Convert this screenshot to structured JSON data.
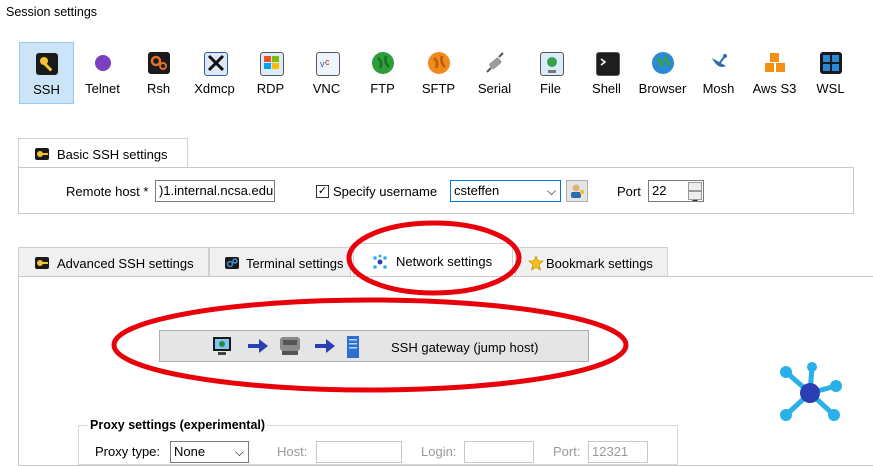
{
  "window": {
    "title": "Session settings"
  },
  "session_types": [
    {
      "label": "SSH",
      "icon": "ssh-key-icon",
      "color": "#d4a017",
      "selected": true
    },
    {
      "label": "Telnet",
      "icon": "telnet-icon",
      "color": "#7b3fbf",
      "selected": false
    },
    {
      "label": "Rsh",
      "icon": "rsh-icon",
      "color": "#c65a1e",
      "selected": false
    },
    {
      "label": "Xdmcp",
      "icon": "xdmcp-icon",
      "color": "#2b5ea7",
      "selected": false
    },
    {
      "label": "RDP",
      "icon": "rdp-icon",
      "color": "#2a7fd4",
      "selected": false
    },
    {
      "label": "VNC",
      "icon": "vnc-icon",
      "color": "#3b8ed0",
      "selected": false
    },
    {
      "label": "FTP",
      "icon": "ftp-globe-icon",
      "color": "#2e9e3a",
      "selected": false
    },
    {
      "label": "SFTP",
      "icon": "sftp-globe-icon",
      "color": "#f08a1c",
      "selected": false
    },
    {
      "label": "Serial",
      "icon": "serial-plug-icon",
      "color": "#8a8a8a",
      "selected": false
    },
    {
      "label": "File",
      "icon": "file-monitor-icon",
      "color": "#3b8ed0",
      "selected": false
    },
    {
      "label": "Shell",
      "icon": "shell-terminal-icon",
      "color": "#1e1e1e",
      "selected": false
    },
    {
      "label": "Browser",
      "icon": "browser-globe-icon",
      "color": "#2a8ad4",
      "selected": false
    },
    {
      "label": "Mosh",
      "icon": "mosh-satellite-icon",
      "color": "#2a6fb0",
      "selected": false
    },
    {
      "label": "Aws S3",
      "icon": "aws-cubes-icon",
      "color": "#f29111",
      "selected": false
    },
    {
      "label": "WSL",
      "icon": "windows-logo-icon",
      "color": "#1f6fd1",
      "selected": false
    }
  ],
  "basic": {
    "tab_label": "Basic SSH settings",
    "remote_host_label": "Remote host *",
    "remote_host_value": ")1.internal.ncsa.edu",
    "specify_username_label": "Specify username",
    "specify_username_checked": true,
    "check_mark": "✓",
    "username_value": "csteffen",
    "dropdown_arrow": "⌵",
    "port_label": "Port",
    "port_value": "22"
  },
  "settings_tabs": [
    {
      "label": "Advanced SSH settings",
      "icon": "advanced-key-icon",
      "active": false
    },
    {
      "label": "Terminal settings",
      "icon": "terminal-icon",
      "active": false
    },
    {
      "label": "Network settings",
      "icon": "network-icon",
      "active": true
    },
    {
      "label": "Bookmark settings",
      "icon": "star-icon",
      "active": false
    }
  ],
  "network": {
    "gateway_button_label": "SSH gateway (jump host)",
    "proxy_group_label": "Proxy settings (experimental)",
    "proxy_type_label": "Proxy type:",
    "proxy_type_value": "None",
    "host_label": "Host:",
    "login_label": "Login:",
    "port_label": "Port:",
    "port_value": "12321"
  },
  "colors": {
    "annotation_red": "#e8000b",
    "selected_bg": "#cce4f7",
    "network_blue": "#2ab0e8",
    "network_dark": "#2b3fb5"
  }
}
